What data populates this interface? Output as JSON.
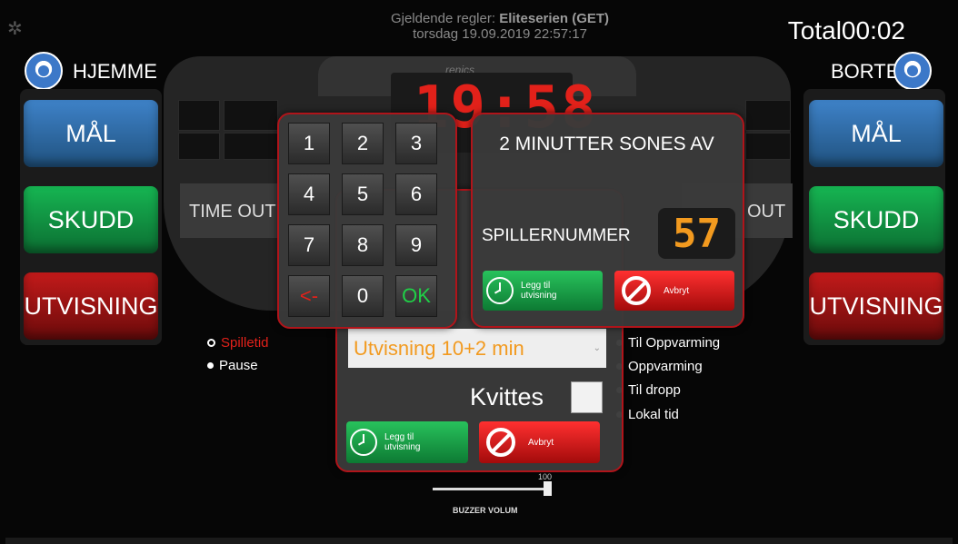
{
  "header": {
    "rules_prefix": "Gjeldende regler:",
    "rules_name": "Eliteserien (GET)",
    "datetime": "torsdag  19.09.2019  22:57:17",
    "total_label": "Total",
    "total_time": "00:02"
  },
  "home": {
    "name": "HJEMME",
    "goal": "MÅL",
    "shot": "SKUDD",
    "penalty": "UTVISNING",
    "timeout": "TIME OUT"
  },
  "away": {
    "name": "BORTE",
    "goal": "MÅL",
    "shot": "SKUDD",
    "penalty": "UTVISNING",
    "timeout_partial": "OUT"
  },
  "scoreboard": {
    "brand": "renics",
    "clock": "19:58"
  },
  "game_modes": [
    "Spilletid",
    "Pause"
  ],
  "pre_game_modes": [
    "Til Oppvarming",
    "Oppvarming",
    "Til dropp",
    "Lokal tid"
  ],
  "penalty_dialog": {
    "selected_penalty": "Utvisning 10+2 min",
    "receipt_label": "Kvittes",
    "add_label": "Legg til utvisning",
    "cancel_label": "Avbryt"
  },
  "keypad": {
    "keys": [
      "1",
      "2",
      "3",
      "4",
      "5",
      "6",
      "7",
      "8",
      "9",
      "<-",
      "0",
      "OK"
    ]
  },
  "player_dialog": {
    "title": "2 MINUTTER SONES AV",
    "player_label": "SPILLERNUMMER",
    "player_number": "57",
    "add_label": "Legg til utvisning",
    "cancel_label": "Avbryt"
  },
  "buzzer": {
    "label": "BUZZER VOLUM",
    "value": "100"
  },
  "colors": {
    "accent_red": "#b0141a",
    "clock_red": "#e2211a",
    "led_orange": "#f29a1f"
  }
}
